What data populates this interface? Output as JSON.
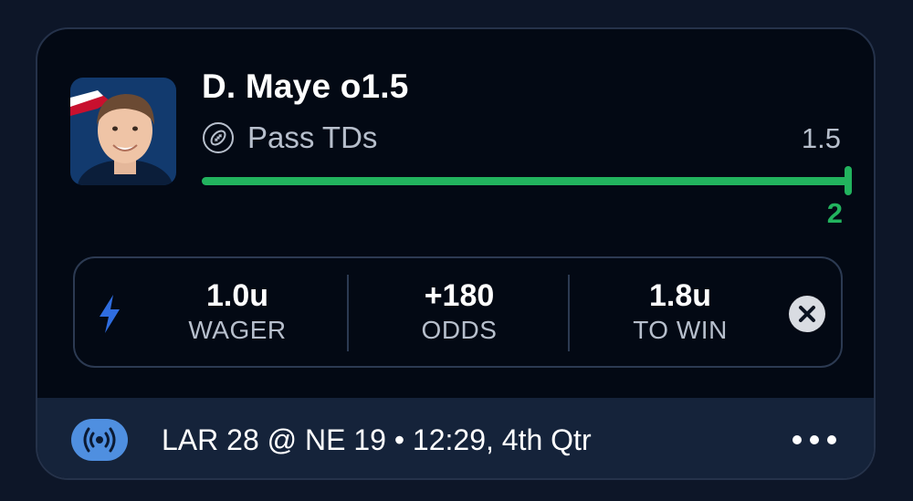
{
  "player": {
    "name": "D. Maye o1.5",
    "stat": "Pass TDs",
    "line": "1.5",
    "actual": "2",
    "progress_fraction": 1.0
  },
  "bet": {
    "wager_value": "1.0u",
    "wager_label": "WAGER",
    "odds_value": "+180",
    "odds_label": "ODDS",
    "to_win_value": "1.8u",
    "to_win_label": "TO WIN"
  },
  "game": {
    "info": "LAR 28 @ NE 19 • 12:29, 4th Qtr"
  },
  "icons": {
    "stat": "football-icon",
    "bet_type": "lightning-bolt-icon",
    "remove": "close-icon",
    "live": "live-broadcast-icon",
    "menu": "more-dots-icon"
  },
  "colors": {
    "background": "#0d1628",
    "card": "#030914",
    "accent_green": "#22b35e",
    "accent_blue": "#2f6de0",
    "live_badge": "#4f8fe0",
    "footer": "#15233a"
  }
}
